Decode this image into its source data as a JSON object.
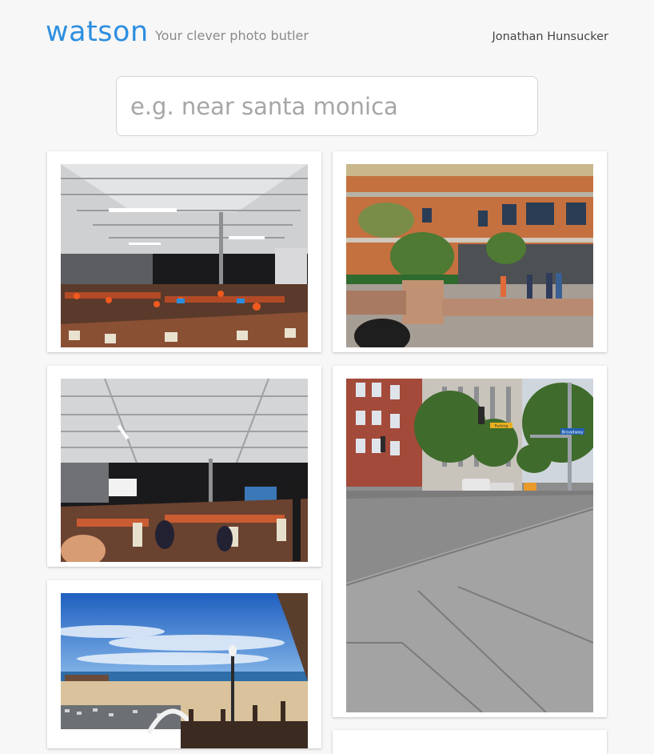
{
  "header": {
    "logo": "watson",
    "tagline": "Your clever photo butler",
    "user_name": "Jonathan Hunsucker"
  },
  "search": {
    "placeholder": "e.g. near santa monica",
    "value": ""
  },
  "photos": [
    {
      "name": "photo-hall-interior-1",
      "street_signs": []
    },
    {
      "name": "photo-santa-monica-plaza",
      "street_signs": []
    },
    {
      "name": "photo-hall-interior-2",
      "street_signs": []
    },
    {
      "name": "photo-street-corner",
      "street_signs": [
        "Broadway",
        "Parking"
      ]
    },
    {
      "name": "photo-santa-monica-beach",
      "street_signs": []
    }
  ],
  "colors": {
    "accent": "#2d8fe0",
    "background": "#f7f7f7",
    "card": "#ffffff"
  }
}
